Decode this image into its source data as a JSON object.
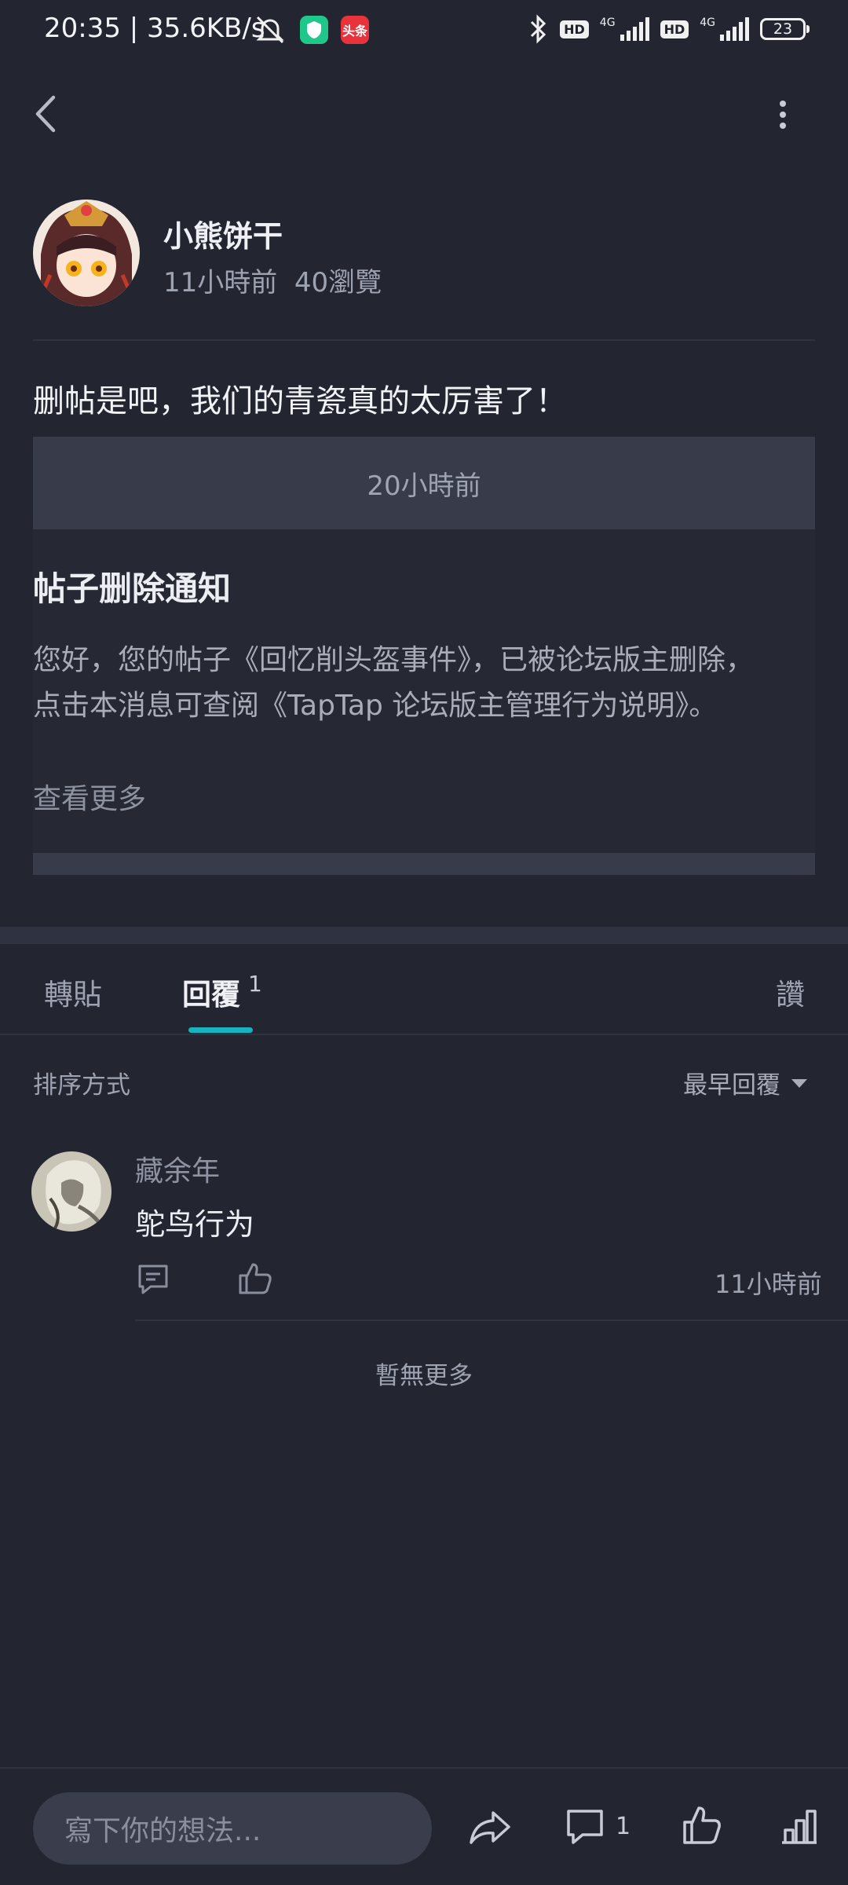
{
  "status_bar": {
    "time": "20:35 | 35.6KB/s",
    "app_badge": "头条",
    "net1": "4G",
    "net2": "4G",
    "hd": "HD",
    "battery": "23"
  },
  "post": {
    "author": "小熊饼干",
    "time": "11小時前",
    "views": "40瀏覽",
    "text": "删帖是吧，我们的青瓷真的太厉害了！",
    "card": {
      "header_time": "20小時前",
      "title": "帖子删除通知",
      "body_line1": "您好，您的帖子《回忆削头盔事件》，已被论坛版主删除，",
      "body_line2": "点击本消息可查阅《TapTap 论坛版主管理行为说明》。",
      "more": "查看更多"
    }
  },
  "tabs": {
    "repost": "轉貼",
    "reply": "回覆",
    "reply_count": "1",
    "like": "讚"
  },
  "sort": {
    "label": "排序方式",
    "value": "最早回覆"
  },
  "comments": [
    {
      "name": "藏余年",
      "text": "鸵鸟行为",
      "time": "11小時前"
    }
  ],
  "no_more": "暫無更多",
  "bottom_bar": {
    "placeholder": "寫下你的想法...",
    "comment_count": "1"
  },
  "colors": {
    "background": "#232531",
    "accent": "#19b3bd",
    "card_header": "#373b4a"
  },
  "icons": [
    "back-icon",
    "more-icon",
    "share-icon",
    "comment-icon",
    "like-icon",
    "stats-icon",
    "reply-icon"
  ]
}
